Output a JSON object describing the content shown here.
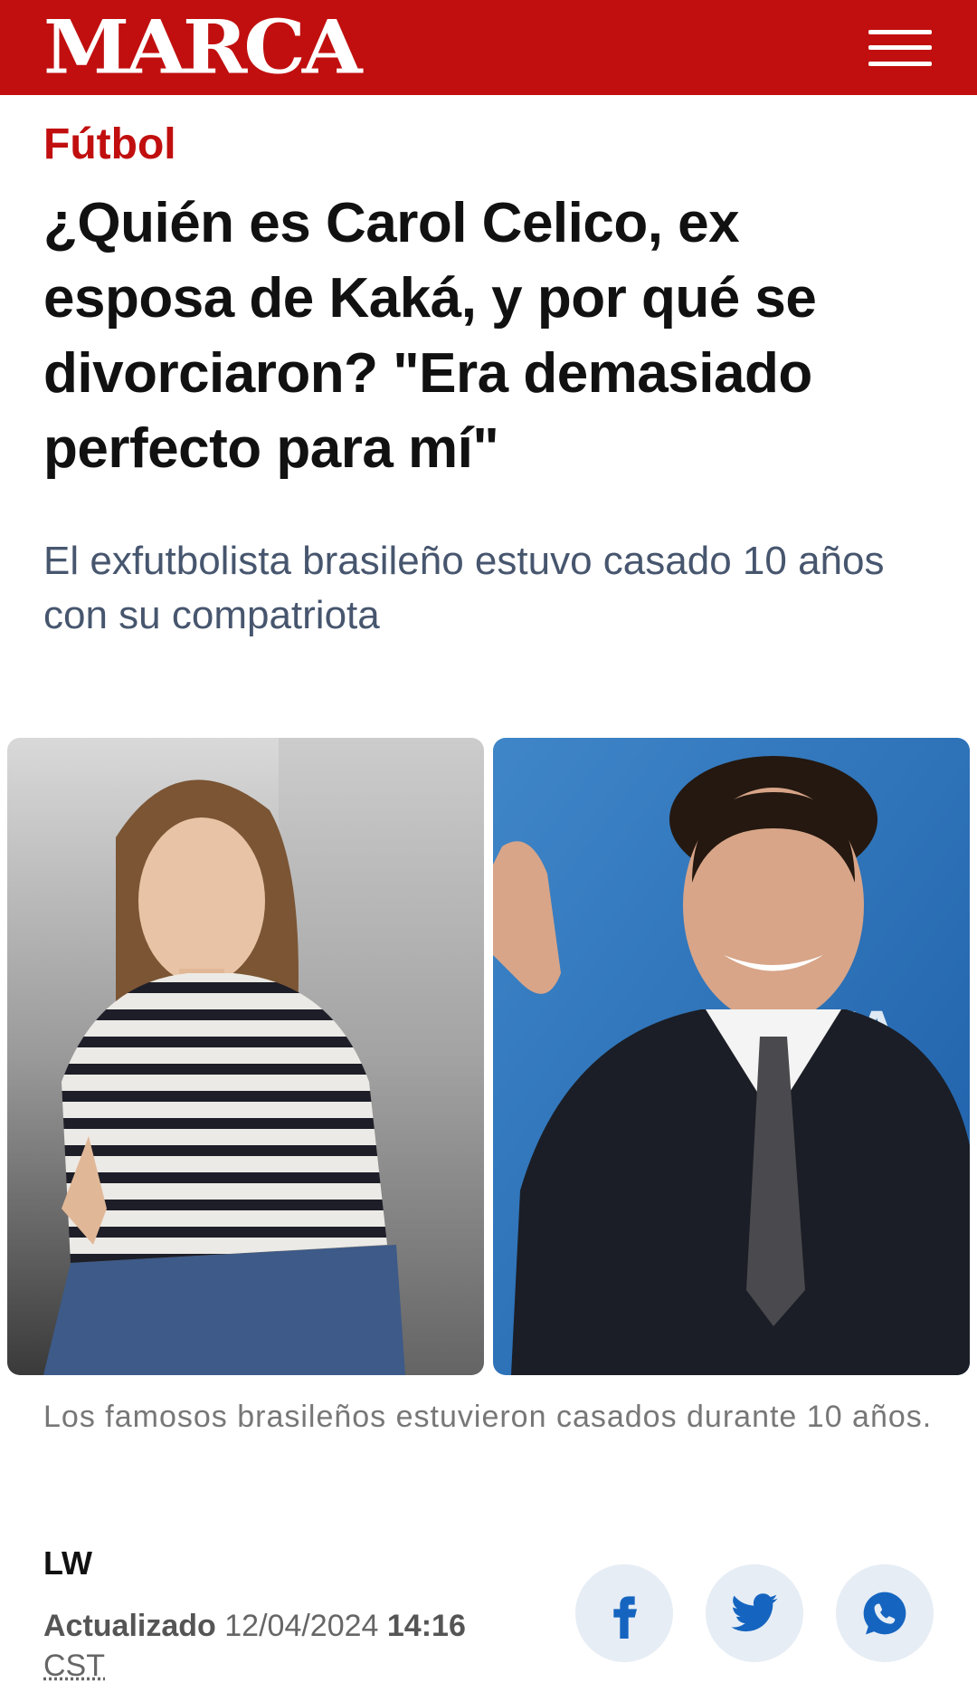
{
  "header": {
    "logo": "MARCA"
  },
  "article": {
    "section": "Fútbol",
    "headline": "¿Quién es Carol Celico, ex esposa de Kaká, y por qué se divorciaron? \"Era demasiado perfecto para mí\"",
    "subtitle": "El exfutbolista brasileño estuvo casado 10 años con su compatriota",
    "caption": "Los famosos brasileños estuvieron casados durante 10 años.",
    "author": "LW",
    "updated_label": "Actualizado",
    "updated_date": "12/04/2024",
    "updated_time": "14:16",
    "timezone": "CST"
  },
  "photo": {
    "right_logo_text": "FA"
  },
  "colors": {
    "brand": "#c10f0f",
    "share_bg": "#e6edf5",
    "share_icon": "#1565c0"
  },
  "icons": [
    "menu-icon",
    "facebook-icon",
    "twitter-icon",
    "whatsapp-icon"
  ]
}
